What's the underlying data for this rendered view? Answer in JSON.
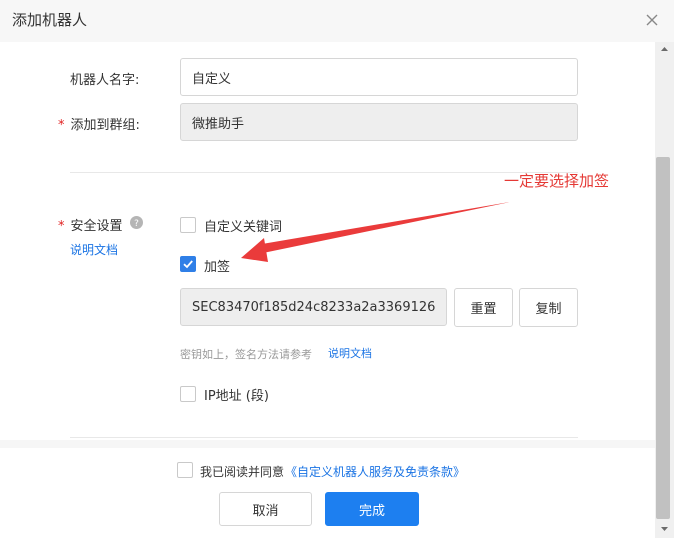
{
  "dialog": {
    "title": "添加机器人"
  },
  "form": {
    "robot_name": {
      "label": "机器人名字:",
      "value": "自定义"
    },
    "group": {
      "label": "添加到群组:",
      "value": "微推助手"
    },
    "security": {
      "label": "安全设置",
      "doc_link": "说明文档",
      "options": {
        "keywords": {
          "label": "自定义关键词",
          "checked": false
        },
        "sign": {
          "label": "加签",
          "checked": true
        },
        "ip": {
          "label": "IP地址 (段)",
          "checked": false
        }
      },
      "secret_value": "SEC83470f185d24c8233a2a3369126",
      "reset_label": "重置",
      "copy_label": "复制",
      "hint_text": "密钥如上，签名方法请参考",
      "hint_link": "说明文档"
    }
  },
  "agreement": {
    "checked": false,
    "text": "我已阅读并同意",
    "link": "《自定义机器人服务及免责条款》"
  },
  "actions": {
    "cancel": "取消",
    "done": "完成"
  },
  "annotation": {
    "text": "一定要选择加签",
    "color": "#e53935"
  },
  "colors": {
    "accent": "#1d7ff0",
    "required": "#e02020"
  }
}
